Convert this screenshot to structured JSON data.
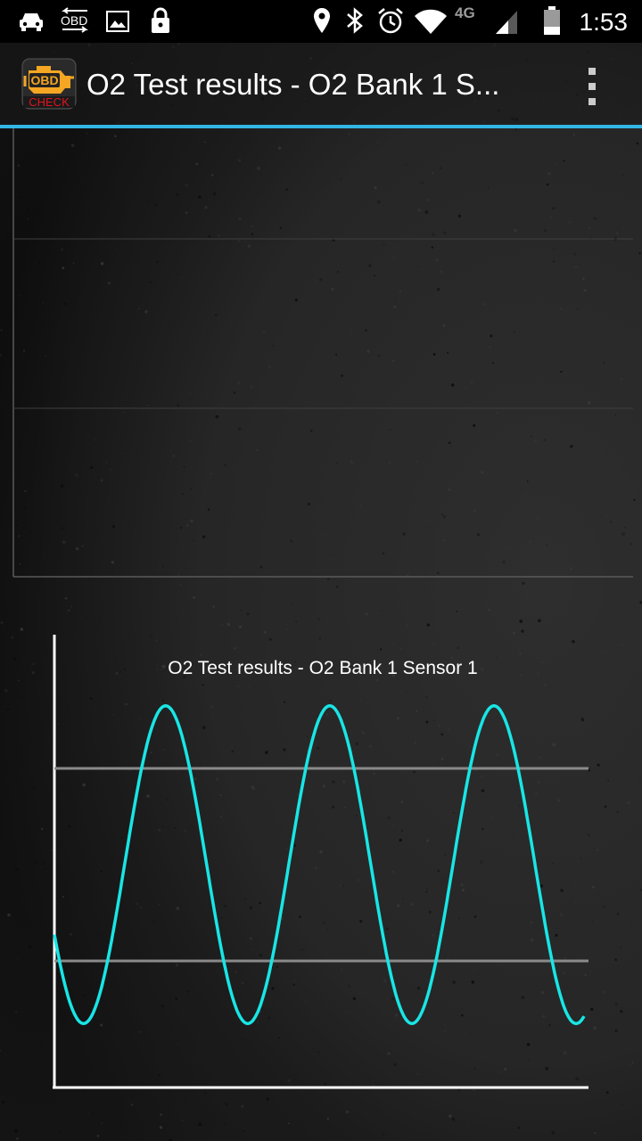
{
  "status_bar": {
    "time": "1:53",
    "network_label": "4G",
    "obd_label": "OBD",
    "icons": [
      "car-icon",
      "obd-sync-icon",
      "image-icon",
      "lock-icon",
      "location-icon",
      "bluetooth-icon",
      "alarm-icon",
      "wifi-icon",
      "signal-icon",
      "battery-icon"
    ]
  },
  "action_bar": {
    "title": "O2 Test results - O2 Bank 1 S...",
    "app_icon": {
      "top_text": "OBD",
      "bottom_text": "CHECK"
    },
    "overflow_icon": "overflow-menu-icon"
  },
  "colors": {
    "accent": "#33b5e5",
    "trace": "#19e5e5",
    "limit_line": "#8a8a8a",
    "icon_orange": "#f5a623",
    "icon_red": "#e0141e"
  },
  "chart_data": [
    {
      "type": "line",
      "title": "",
      "series": [],
      "grid": true,
      "horizontal_gridlines": 2
    },
    {
      "type": "line",
      "title": "O2 Test results - O2 Bank 1 Sensor 1",
      "xlabel": "",
      "ylabel": "",
      "grid": false,
      "ylim": [
        0,
        1
      ],
      "x": [
        0,
        0.1,
        0.2,
        0.3,
        0.4,
        0.5,
        0.6,
        0.7,
        0.8,
        0.9,
        1.0
      ],
      "series": [
        {
          "waveform": "sine",
          "cycles_visible": 3.25,
          "min": 0.17,
          "max": 0.83,
          "start_value": 0.35,
          "end_value": 0.19,
          "peaks_x": [
            0.21,
            0.52,
            0.83
          ],
          "troughs_x": [
            0.05,
            0.36,
            0.67,
            0.98
          ]
        }
      ],
      "limit_lines": [
        0.7,
        0.3
      ]
    }
  ]
}
